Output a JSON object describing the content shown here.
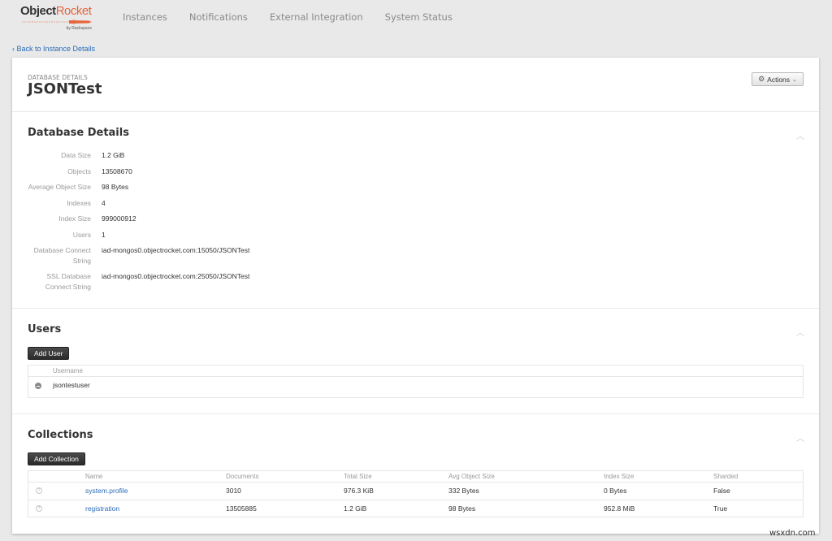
{
  "brand": {
    "name_part1": "Object",
    "name_part2": "Rocket",
    "tagline": "by Rackspace",
    "accent_color": "#e8643c"
  },
  "nav": {
    "items": [
      {
        "label": "Instances"
      },
      {
        "label": "Notifications"
      },
      {
        "label": "External Integration"
      },
      {
        "label": "System Status"
      }
    ]
  },
  "back_link": "‹ Back to Instance Details",
  "header": {
    "eyebrow": "DATABASE DETAILS",
    "title": "JSONTest",
    "actions_label": "Actions",
    "actions_icon": "gear-icon"
  },
  "details": {
    "title": "Database Details",
    "rows": [
      {
        "label": "Data Size",
        "value": "1.2 GiB"
      },
      {
        "label": "Objects",
        "value": "13508670"
      },
      {
        "label": "Average Object Size",
        "value": "98 Bytes"
      },
      {
        "label": "Indexes",
        "value": "4"
      },
      {
        "label": "Index Size",
        "value": "999000912"
      },
      {
        "label": "Users",
        "value": "1"
      },
      {
        "label_line1": "Database Connect",
        "label_line2": "String",
        "value": "iad-mongos0.objectrocket.com:15050/JSONTest"
      },
      {
        "label_line1": "SSL Database",
        "label_line2": "Connect String",
        "value": "iad-mongos0.objectrocket.com:25050/JSONTest"
      }
    ]
  },
  "users": {
    "title": "Users",
    "add_button": "Add User",
    "columns": [
      "Username"
    ],
    "rows": [
      {
        "username": "jsontestuser"
      }
    ]
  },
  "collections": {
    "title": "Collections",
    "add_button": "Add Collection",
    "columns": [
      "Name",
      "Documents",
      "Total Size",
      "Avg Object Size",
      "Index Size",
      "Sharded"
    ],
    "rows": [
      {
        "help": "?",
        "name": "system.profile",
        "documents": "3010",
        "total_size": "976.3 KiB",
        "avg_object_size": "332 Bytes",
        "index_size": "0 Bytes",
        "sharded": "False"
      },
      {
        "help": "?",
        "name": "registration",
        "documents": "13505885",
        "total_size": "1.2 GiB",
        "avg_object_size": "98 Bytes",
        "index_size": "952.8 MiB",
        "sharded": "True"
      }
    ]
  },
  "watermark": "wsxdn.com"
}
